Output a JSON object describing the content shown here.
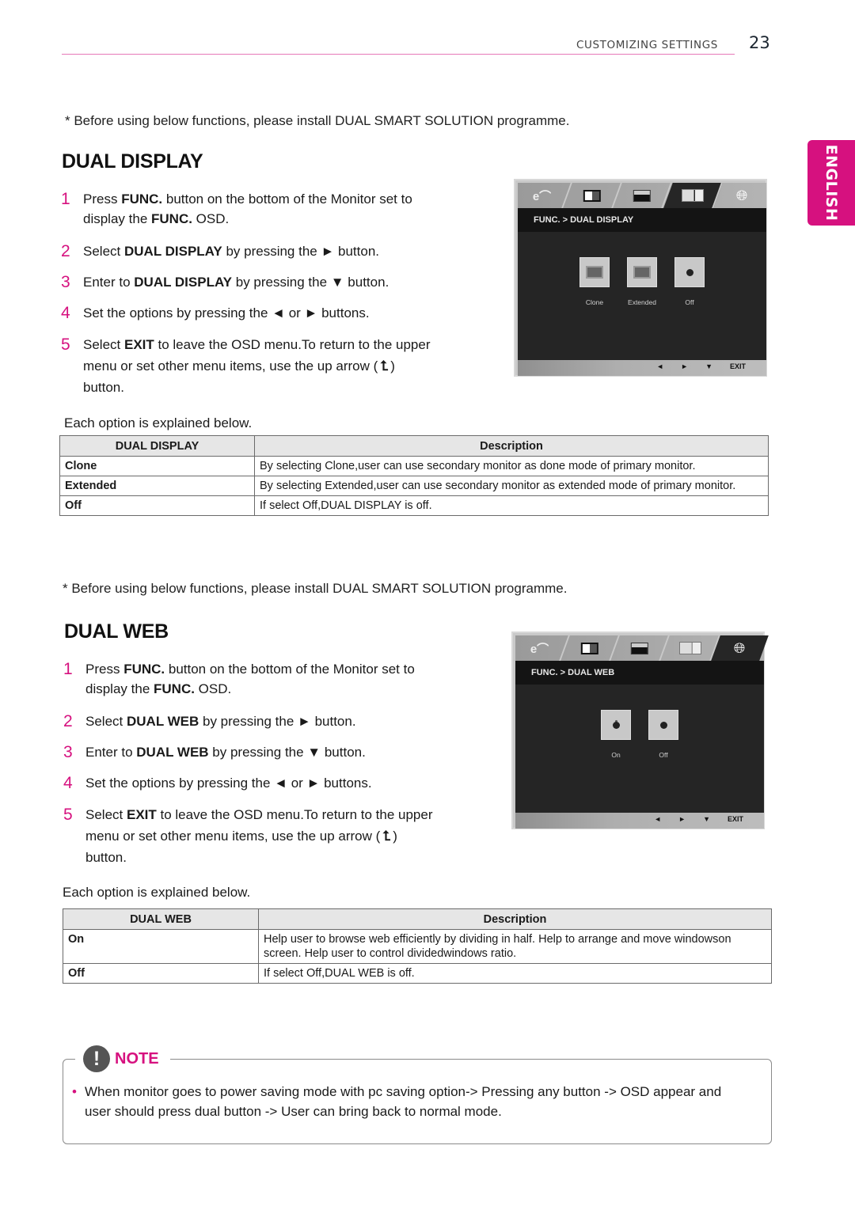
{
  "header": {
    "section": "CUSTOMIZING SETTINGS",
    "page_number": "23",
    "accent_color": "#d6117f"
  },
  "language_tab": "ENGLISH",
  "dual_display": {
    "pre_note": "* Before using below functions, please install DUAL SMART SOLUTION programme.",
    "title": "DUAL DISPLAY",
    "steps": [
      {
        "num": "1",
        "a": "Press ",
        "b1": "FUNC.",
        "c": " button on the bottom of the Monitor set to display the ",
        "b2": "FUNC.",
        "d": " OSD."
      },
      {
        "num": "2",
        "a": "Select ",
        "b1": "DUAL DISPLAY",
        "c": " by pressing the ► button."
      },
      {
        "num": "3",
        "a": "Enter to ",
        "b1": "DUAL DISPLAY",
        "c": " by pressing the ▼ button."
      },
      {
        "num": "4",
        "a": "Set the options by pressing the ◄ or ► buttons."
      },
      {
        "num": "5",
        "a": "Select ",
        "b1": "EXIT",
        "c": " to leave the OSD menu.To return to the upper menu or set other menu items, use the up arrow (",
        "arrow": "⮤",
        "d": ") button."
      }
    ],
    "each_option": "Each option is explained below.",
    "table": {
      "headers": [
        "DUAL DISPLAY",
        "Description"
      ],
      "rows": [
        {
          "key": "Clone",
          "desc": "By selecting Clone,user can use secondary monitor as done mode of primary monitor."
        },
        {
          "key": "Extended",
          "desc": "By selecting Extended,user can use secondary monitor as extended mode of primary monitor."
        },
        {
          "key": "Off",
          "desc": "If select Off,DUAL DISPLAY is off."
        }
      ]
    },
    "osd": {
      "breadcrumb": "FUNC.  >  DUAL DISPLAY",
      "options": [
        "Clone",
        "Extended",
        "Off"
      ],
      "footer_keys": [
        "◄",
        "►",
        "▼",
        "EXIT"
      ]
    }
  },
  "dual_web": {
    "pre_note": "* Before using below functions, please install DUAL SMART SOLUTION programme.",
    "title": "DUAL WEB",
    "steps": [
      {
        "num": "1",
        "a": "Press ",
        "b1": "FUNC.",
        "c": " button on the bottom of the Monitor set to display the ",
        "b2": "FUNC.",
        "d": " OSD."
      },
      {
        "num": "2",
        "a": "Select ",
        "b1": "DUAL WEB",
        "c": " by pressing the ► button."
      },
      {
        "num": "3",
        "a": "Enter to ",
        "b1": "DUAL WEB",
        "c": " by pressing the ▼ button."
      },
      {
        "num": "4",
        "a": "Set the options by pressing the ◄ or ► buttons."
      },
      {
        "num": "5",
        "a": "Select ",
        "b1": "EXIT",
        "c": " to leave the OSD menu.To return to the upper menu or set other menu items, use the up arrow (",
        "arrow": "⮤",
        "d": ") button."
      }
    ],
    "each_option": "Each option is explained below.",
    "table": {
      "headers": [
        "DUAL WEB",
        "Description"
      ],
      "rows": [
        {
          "key": "On",
          "desc": "Help user to browse web efficiently by dividing in half. Help to arrange and move windowson screen. Help user to control dividedwindows ratio."
        },
        {
          "key": "Off",
          "desc": "If select Off,DUAL WEB is off."
        }
      ]
    },
    "osd": {
      "breadcrumb": "FUNC.  >  DUAL WEB",
      "options": [
        "On",
        "Off"
      ],
      "footer_keys": [
        "◄",
        "►",
        "▼",
        "EXIT"
      ]
    }
  },
  "note": {
    "label": "NOTE",
    "icon": "!",
    "bullet": "•",
    "text": "When monitor goes to power saving mode with pc saving option-> Pressing any button -> OSD appear and user should press dual button -> User can bring back to normal mode."
  }
}
